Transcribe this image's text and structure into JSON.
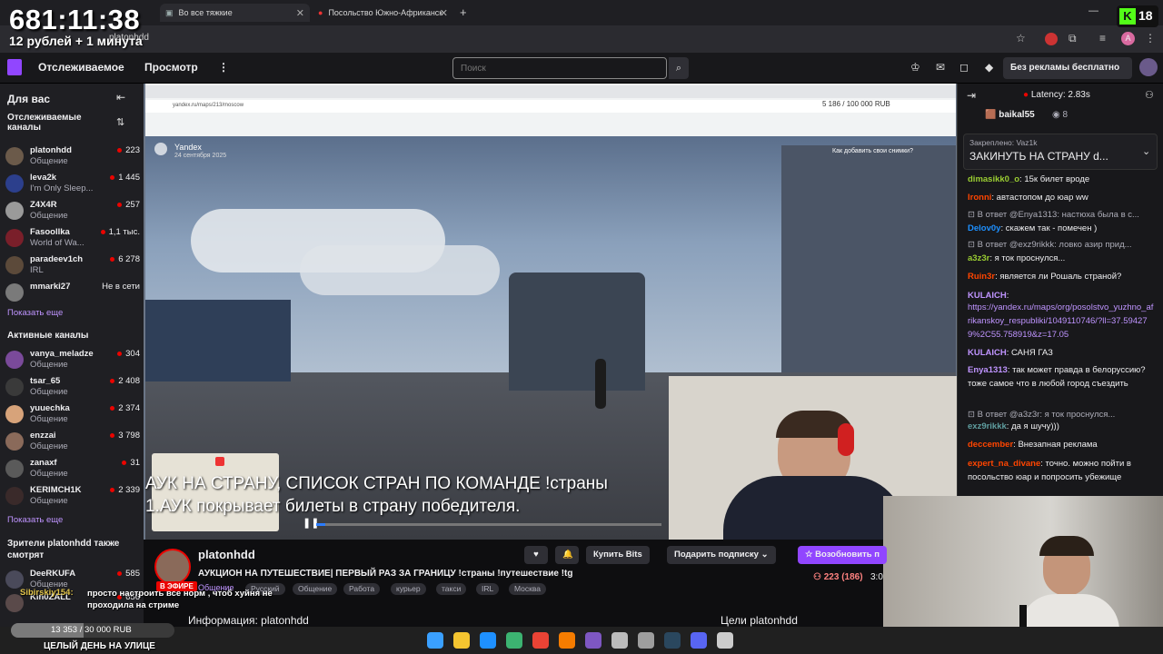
{
  "overlay": {
    "timer": "681:11:38",
    "rubles": "12 рублей + 1 минута",
    "k_count": "18"
  },
  "browser": {
    "tabs": [
      {
        "label": "Во все тяжкие"
      },
      {
        "label": "Посольство Южно-Африканск"
      }
    ],
    "address": "platonhdd"
  },
  "nav": {
    "following": "Отслеживаемое",
    "browse": "Просмотр",
    "search_placeholder": "Поиск",
    "no_ads": "Без рекламы бесплатно"
  },
  "sidebar": {
    "for_you": "Для вас",
    "followed_title": "Отслеживаемые каналы",
    "followed": [
      {
        "name": "platonhdd",
        "category": "Общение",
        "viewers": "223",
        "color": "#6b5a4a"
      },
      {
        "name": "leva2k",
        "category": "I'm Only Sleep...",
        "viewers": "1 445",
        "color": "#2c3f8c"
      },
      {
        "name": "Z4X4R",
        "category": "Общение",
        "viewers": "257",
        "color": "#9a9a9a"
      },
      {
        "name": "Fasoollka",
        "category": "World of Wa...",
        "viewers": "1,1 тыс.",
        "color": "#7a1f2a"
      },
      {
        "name": "paradeev1ch",
        "category": "IRL",
        "viewers": "6 278",
        "color": "#5c4a3a"
      },
      {
        "name": "mmarki27",
        "category": "",
        "viewers": "Не в сети",
        "color": "#7a7a7a"
      }
    ],
    "show_more_1": "Показать еще",
    "active_title": "Активные каналы",
    "active": [
      {
        "name": "vanya_meladze",
        "category": "Общение",
        "viewers": "304",
        "color": "#7a4a9a"
      },
      {
        "name": "tsar_65",
        "category": "Общение",
        "viewers": "2 408",
        "color": "#3a3a3a"
      },
      {
        "name": "yuuechka",
        "category": "Общение",
        "viewers": "2 374",
        "color": "#d7a37a"
      },
      {
        "name": "enzzai",
        "category": "Общение",
        "viewers": "3 798",
        "color": "#8a6a5a"
      },
      {
        "name": "zanaxf",
        "category": "Общение",
        "viewers": "31",
        "color": "#5a5a5a"
      },
      {
        "name": "KERIMCH1K",
        "category": "Общение",
        "viewers": "2 339",
        "color": "#3a2a2a"
      }
    ],
    "show_more_2": "Показать еще",
    "also_watch": "Зрители platonhdd также смотрят",
    "also": [
      {
        "name": "DeeRKUFA",
        "category": "Общение",
        "viewers": "585",
        "color": "#4a4a5a"
      },
      {
        "name": "Kin0ZALL",
        "category": "",
        "viewers": "656",
        "color": "#5a4a4a"
      }
    ]
  },
  "video": {
    "inner_counter": "5 186 / 100 000 RUB",
    "yandex": "Yandex",
    "yandex_date": "24 сентября 2025",
    "add_photo": "Как добавить свои снимки?",
    "subtitle1": "АУК НА СТРАНУ, СПИСОК СТРАН ПО КОМАНДЕ !страны",
    "subtitle2": "1.АУК покрывает билеты в страну победителя."
  },
  "stream": {
    "channel": "platonhdd",
    "title": "АУКЦИОН НА ПУТЕШЕСТВИЕ| ПЕРВЫЙ РАЗ ЗА ГРАНИЦУ !страны !путешествие !tg",
    "live": "В ЭФИРЕ",
    "category": "Общение",
    "tags": [
      "Русский",
      "Общение",
      "Работа",
      "курьер",
      "такси",
      "IRL",
      "Москва"
    ],
    "viewers": "223 (186)",
    "uptime": "3:0",
    "bits": "Купить Bits",
    "gift": "Подарить подписку",
    "resub": "Возобновить п",
    "info": "Информация: platonhdd",
    "goals": "Цели platonhdd"
  },
  "chat": {
    "latency": "Latency: 2.83s",
    "top_user": "baikal55",
    "top_count": "8",
    "pinned_by": "Закреплено: Vaz1k",
    "pinned_text": "ЗАКИНУТЬ НА СТРАНУ d...",
    "messages": [
      {
        "user": "dimasikk0_o",
        "color": "#9acd32",
        "text": "15к билет вроде"
      },
      {
        "user": "Ironni",
        "color": "#ff4500",
        "text": "автастопом до юар ww"
      },
      {
        "reply": "В ответ @Enya1313: настюха была в с..."
      },
      {
        "user": "Delov0y",
        "color": "#1e90ff",
        "text": "скажем так - помечен )"
      },
      {
        "reply": "В ответ @exz9rikkk: ловко азир прид..."
      },
      {
        "user": "a3z3r",
        "color": "#9acd32",
        "text": "я ток проснулся..."
      },
      {
        "user": "Ruin3r",
        "color": "#ff4500",
        "text": "является ли Рошаль страной?"
      },
      {
        "user": "KULAICH",
        "color": "#bf94ff",
        "text": ""
      },
      {
        "link": "https://yandex.ru/maps/org/posolstvo_yuzhno_afrikanskoy_respubliki/1049110746/?ll=37.594279%2C55.758919&z=17.05"
      },
      {
        "user": "KULAICH",
        "color": "#bf94ff",
        "text": "САНЯ ГАЗ"
      },
      {
        "user": "Enya1313",
        "color": "#bf94ff",
        "text": "так может правда в белоруссию? тоже самое что в любой город съездить"
      },
      {
        "reply": "В ответ @a3z3r: я ток проснулся..."
      },
      {
        "user": "exz9rikkk",
        "color": "#5f9ea0",
        "text": "да я шучу)))"
      },
      {
        "user": "deccember",
        "color": "#ff4500",
        "text": "Внезапная реклама"
      },
      {
        "user": "expert_na_divane",
        "color": "#ff4500",
        "text": "точно. можно пойти в посольство юар и попросить убежище"
      }
    ]
  },
  "bottom_overlay": {
    "chat_user": "Sibirskiy154:",
    "chat_msg": "просто настроить все норм , чтоб хуйня не проходила на стриме",
    "goal": "13 353 / 30 000 RUB",
    "goal_progress": 0.445,
    "goal_caption": "ЦЕЛЫЙ ДЕНЬ НА УЛИЦЕ"
  }
}
